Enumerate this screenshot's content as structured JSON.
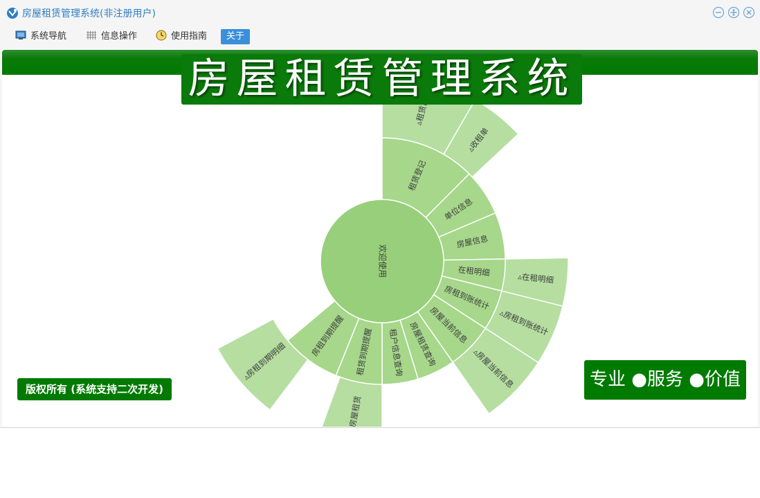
{
  "window": {
    "title": "房屋租赁管理系统(非注册用户)"
  },
  "menu": {
    "items": [
      {
        "label": "系统导航",
        "icon": "monitor-icon"
      },
      {
        "label": "信息操作",
        "icon": "grid-icon"
      },
      {
        "label": "使用指南",
        "icon": "clock-icon"
      },
      {
        "label": "关于",
        "icon": ""
      }
    ]
  },
  "banner": {
    "title": "房屋租赁管理系统"
  },
  "footer": {
    "copyright": "版权所有 (系统支持二次开发)",
    "slogan": "专业 ●服务 ●价值"
  },
  "colors": {
    "title_blue": "#2f7fc4",
    "brand_green": "#007a00",
    "sun_inner": "#98cf7a",
    "sun_mid": "#a6d78a",
    "sun_outer": "#b5dea0",
    "about_blue": "#3a8fd9"
  },
  "chart_data": {
    "type": "sunburst",
    "center": "欢迎使用",
    "rings": [
      {
        "level": 1,
        "segments": [
          "租赁登记",
          "单位信息",
          "房屋信息",
          "在租明细",
          "房租到账统计",
          "房屋当前信息",
          "房屋租赁查询",
          "租户信息查询",
          "租赁到期提醒",
          "房租到期提醒"
        ]
      },
      {
        "level": 2,
        "segments": [
          "租赁口",
          "收租单",
          "在租明细",
          "房租到账统计",
          "房屋当前信息",
          "房屋租赁",
          "房租到期明细"
        ]
      }
    ],
    "labels": {
      "center": "欢迎使用",
      "inner": [
        "租赁登记",
        "单位信息",
        "房屋信息",
        "在租明细",
        "房租到账统计",
        "房屋当前信息",
        "房屋租赁查询",
        "租户信息查询",
        "租赁到期提醒",
        "房租到期提醒"
      ],
      "outer": [
        "▵租赁口",
        "▵收租单",
        "▵在租明细",
        "▵房租到账统计",
        "▵房屋当前信息",
        "▵房屋租赁",
        "▵房租到期明细"
      ]
    }
  }
}
